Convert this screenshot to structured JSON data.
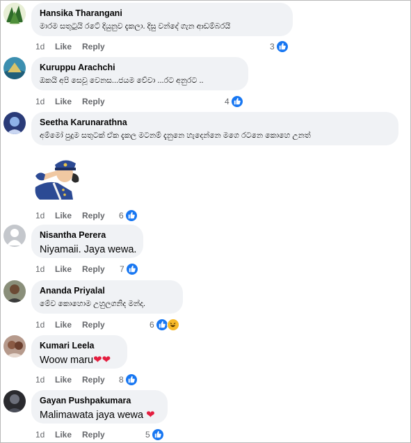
{
  "comments": [
    {
      "author": "Hansika Tharangani",
      "text": "මාරම සතුටුයි රටේ දියුනුව දැකලා. දිසු වන්දේ ගැන ආඩම්බරයි",
      "time": "1d",
      "like": "Like",
      "reply": "Reply",
      "reactions": "3"
    },
    {
      "author": "Kuruppu Arachchi",
      "text": "ඔකයි අපි සෙවූ වෙනස...ජයම වේවා ...රට අනුරට ..",
      "time": "1d",
      "like": "Like",
      "reply": "Reply",
      "reactions": "4"
    },
    {
      "author": "Seetha Karunarathna",
      "text": "අම්මෝ පුදුම සතුටක් ඒක දැකල මටනම් දැනුනෙ හැදෙන්නෙ මගෙ රටනෙ කොහෙ උනත්",
      "time": "1d",
      "like": "Like",
      "reply": "Reply",
      "reactions": "6"
    },
    {
      "author": "Nisantha Perera",
      "text": "Niyamaii. Jaya wewa.",
      "time": "1d",
      "like": "Like",
      "reply": "Reply",
      "reactions": "7"
    },
    {
      "author": "Ananda Priyalal",
      "text": "මේව කොහොම උහුලගනිද මන්දා.",
      "time": "1d",
      "like": "Like",
      "reply": "Reply",
      "reactions": "6"
    },
    {
      "author": "Kumari Leela",
      "text": "Woow maru",
      "time": "1d",
      "like": "Like",
      "reply": "Reply",
      "reactions": "8"
    },
    {
      "author": "Gayan Pushpakumara",
      "text": "Malimawata jaya wewa",
      "time": "1d",
      "like": "Like",
      "reply": "Reply",
      "reactions": "5"
    }
  ],
  "colors": {
    "like_blue": "#1877f2",
    "bubble_bg": "#f0f2f5",
    "meta_gray": "#65676b",
    "heart": "#e41e3f"
  },
  "icons": {
    "like": "like-icon",
    "haha": "haha-icon",
    "heart": "heart-icon",
    "sticker": "saluting-officer-sticker"
  }
}
